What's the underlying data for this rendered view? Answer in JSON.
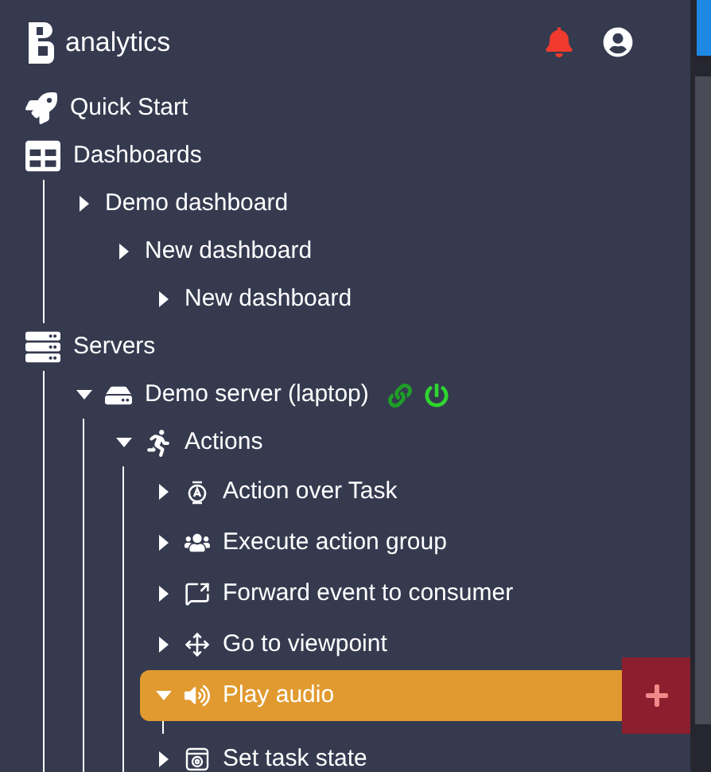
{
  "header": {
    "brand": "analytics",
    "notifications_alert": true
  },
  "tree": [
    {
      "label": "Quick Start"
    },
    {
      "label": "Dashboards",
      "children": [
        {
          "label": "Demo dashboard",
          "expanded": false,
          "children": [
            {
              "label": "New dashboard",
              "expanded": false,
              "children": [
                {
                  "label": "New dashboard",
                  "expanded": false
                }
              ]
            }
          ]
        }
      ]
    },
    {
      "label": "Servers",
      "children": [
        {
          "label": "Demo server (laptop)",
          "expanded": true,
          "linked": true,
          "powered": true,
          "children": [
            {
              "label": "Actions",
              "expanded": true,
              "children": [
                {
                  "label": "Action over Task",
                  "expanded": false,
                  "selected": false
                },
                {
                  "label": "Execute action group",
                  "expanded": false,
                  "selected": false
                },
                {
                  "label": "Forward event to consumer",
                  "expanded": false,
                  "selected": false
                },
                {
                  "label": "Go to viewpoint",
                  "expanded": false,
                  "selected": false
                },
                {
                  "label": "Play audio",
                  "expanded": true,
                  "selected": true
                },
                {
                  "label": "Set task state",
                  "expanded": false,
                  "selected": false
                }
              ]
            }
          ]
        }
      ]
    }
  ]
}
